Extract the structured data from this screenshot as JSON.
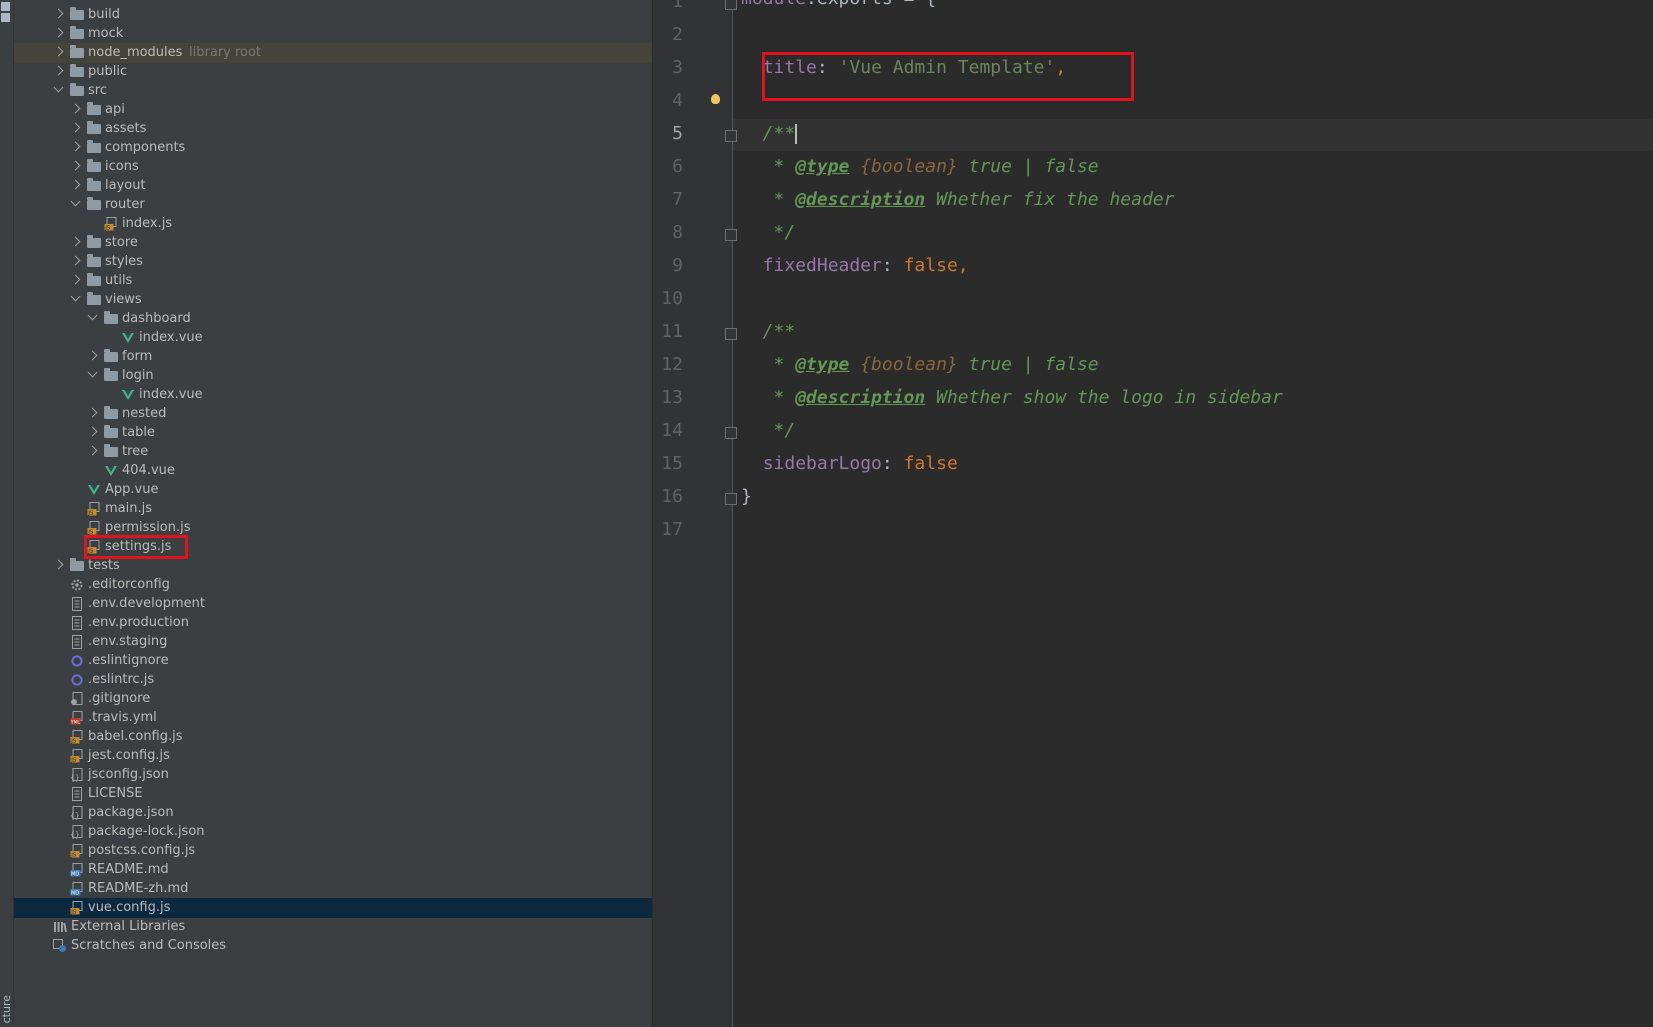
{
  "project_tree": {
    "items": [
      {
        "label": "build",
        "kind": "folder",
        "depth": 1,
        "expander": "closed"
      },
      {
        "label": "mock",
        "kind": "folder",
        "depth": 1,
        "expander": "closed"
      },
      {
        "label": "node_modules",
        "kind": "folder",
        "depth": 1,
        "expander": "closed",
        "hint": "library root",
        "highlight": true
      },
      {
        "label": "public",
        "kind": "folder",
        "depth": 1,
        "expander": "closed"
      },
      {
        "label": "src",
        "kind": "folder",
        "depth": 1,
        "expander": "open"
      },
      {
        "label": "api",
        "kind": "folder",
        "depth": 2,
        "expander": "closed"
      },
      {
        "label": "assets",
        "kind": "folder",
        "depth": 2,
        "expander": "closed"
      },
      {
        "label": "components",
        "kind": "folder",
        "depth": 2,
        "expander": "closed"
      },
      {
        "label": "icons",
        "kind": "folder",
        "depth": 2,
        "expander": "closed"
      },
      {
        "label": "layout",
        "kind": "folder",
        "depth": 2,
        "expander": "closed"
      },
      {
        "label": "router",
        "kind": "folder",
        "depth": 2,
        "expander": "open"
      },
      {
        "label": "index.js",
        "kind": "js",
        "depth": 3
      },
      {
        "label": "store",
        "kind": "folder",
        "depth": 2,
        "expander": "closed"
      },
      {
        "label": "styles",
        "kind": "folder",
        "depth": 2,
        "expander": "closed"
      },
      {
        "label": "utils",
        "kind": "folder",
        "depth": 2,
        "expander": "closed"
      },
      {
        "label": "views",
        "kind": "folder",
        "depth": 2,
        "expander": "open"
      },
      {
        "label": "dashboard",
        "kind": "folder",
        "depth": 3,
        "expander": "open"
      },
      {
        "label": "index.vue",
        "kind": "vue",
        "depth": 4
      },
      {
        "label": "form",
        "kind": "folder",
        "depth": 3,
        "expander": "closed"
      },
      {
        "label": "login",
        "kind": "folder",
        "depth": 3,
        "expander": "open"
      },
      {
        "label": "index.vue",
        "kind": "vue",
        "depth": 4
      },
      {
        "label": "nested",
        "kind": "folder",
        "depth": 3,
        "expander": "closed"
      },
      {
        "label": "table",
        "kind": "folder",
        "depth": 3,
        "expander": "closed"
      },
      {
        "label": "tree",
        "kind": "folder",
        "depth": 3,
        "expander": "closed"
      },
      {
        "label": "404.vue",
        "kind": "vue",
        "depth": 3
      },
      {
        "label": "App.vue",
        "kind": "vue",
        "depth": 2
      },
      {
        "label": "main.js",
        "kind": "js",
        "depth": 2
      },
      {
        "label": "permission.js",
        "kind": "js",
        "depth": 2
      },
      {
        "label": "settings.js",
        "kind": "js",
        "depth": 2,
        "boxed": true
      },
      {
        "label": "tests",
        "kind": "folder",
        "depth": 1,
        "expander": "closed"
      },
      {
        "label": ".editorconfig",
        "kind": "gear",
        "depth": 1
      },
      {
        "label": ".env.development",
        "kind": "file",
        "depth": 1
      },
      {
        "label": ".env.production",
        "kind": "file",
        "depth": 1
      },
      {
        "label": ".env.staging",
        "kind": "file",
        "depth": 1
      },
      {
        "label": ".eslintignore",
        "kind": "eslint",
        "depth": 1
      },
      {
        "label": ".eslintrc.js",
        "kind": "eslint",
        "depth": 1
      },
      {
        "label": ".gitignore",
        "kind": "git",
        "depth": 1
      },
      {
        "label": ".travis.yml",
        "kind": "yml",
        "depth": 1
      },
      {
        "label": "babel.config.js",
        "kind": "js",
        "depth": 1
      },
      {
        "label": "jest.config.js",
        "kind": "js",
        "depth": 1
      },
      {
        "label": "jsconfig.json",
        "kind": "json",
        "depth": 1
      },
      {
        "label": "LICENSE",
        "kind": "file",
        "depth": 1
      },
      {
        "label": "package.json",
        "kind": "json",
        "depth": 1
      },
      {
        "label": "package-lock.json",
        "kind": "json",
        "depth": 1
      },
      {
        "label": "postcss.config.js",
        "kind": "js",
        "depth": 1
      },
      {
        "label": "README.md",
        "kind": "md",
        "depth": 1
      },
      {
        "label": "README-zh.md",
        "kind": "md",
        "depth": 1
      },
      {
        "label": "vue.config.js",
        "kind": "js",
        "depth": 1,
        "selected": true
      },
      {
        "label": "External Libraries",
        "kind": "libs",
        "depth": 0
      },
      {
        "label": "Scratches and Consoles",
        "kind": "scratch",
        "depth": 0
      }
    ]
  },
  "side_strip": {
    "label": "cture"
  },
  "editor": {
    "current_line": 5,
    "lines": [
      {
        "n": "1",
        "fold": "start",
        "tokens": [
          {
            "t": "module",
            "c": "t-prop"
          },
          {
            "t": ".exports = {",
            "c": ""
          }
        ],
        "clip": true
      },
      {
        "n": "2",
        "tokens": []
      },
      {
        "n": "3",
        "boxed": true,
        "tokens": [
          {
            "t": "  ",
            "c": ""
          },
          {
            "t": "title",
            "c": "t-prop"
          },
          {
            "t": ": ",
            "c": ""
          },
          {
            "t": "'Vue Admin Template'",
            "c": "t-str"
          },
          {
            "t": ",",
            "c": "t-kw"
          }
        ]
      },
      {
        "n": "4",
        "bulb": true,
        "tokens": []
      },
      {
        "n": "5",
        "fold": "start",
        "cursor": true,
        "tokens": [
          {
            "t": "  /**",
            "c": "t-doc"
          }
        ]
      },
      {
        "n": "6",
        "tokens": [
          {
            "t": "   * ",
            "c": "t-doc"
          },
          {
            "t": "@type",
            "c": "t-tag"
          },
          {
            "t": " ",
            "c": "t-doc"
          },
          {
            "t": "{boolean}",
            "c": "t-type"
          },
          {
            "t": " true | false",
            "c": "t-doc"
          }
        ]
      },
      {
        "n": "7",
        "tokens": [
          {
            "t": "   * ",
            "c": "t-doc"
          },
          {
            "t": "@description",
            "c": "t-tag"
          },
          {
            "t": " Whether fix the header",
            "c": "t-doc"
          }
        ]
      },
      {
        "n": "8",
        "fold": "end",
        "tokens": [
          {
            "t": "   */",
            "c": "t-doc"
          }
        ]
      },
      {
        "n": "9",
        "tokens": [
          {
            "t": "  ",
            "c": ""
          },
          {
            "t": "fixedHeader",
            "c": "t-prop"
          },
          {
            "t": ": ",
            "c": ""
          },
          {
            "t": "false,",
            "c": "t-kw"
          }
        ]
      },
      {
        "n": "10",
        "tokens": []
      },
      {
        "n": "11",
        "fold": "start",
        "tokens": [
          {
            "t": "  /**",
            "c": "t-doc"
          }
        ]
      },
      {
        "n": "12",
        "tokens": [
          {
            "t": "   * ",
            "c": "t-doc"
          },
          {
            "t": "@type",
            "c": "t-tag"
          },
          {
            "t": " ",
            "c": "t-doc"
          },
          {
            "t": "{boolean}",
            "c": "t-type"
          },
          {
            "t": " true | false",
            "c": "t-doc"
          }
        ]
      },
      {
        "n": "13",
        "tokens": [
          {
            "t": "   * ",
            "c": "t-doc"
          },
          {
            "t": "@description",
            "c": "t-tag"
          },
          {
            "t": " Whether show the logo in sidebar",
            "c": "t-doc"
          }
        ]
      },
      {
        "n": "14",
        "fold": "end",
        "tokens": [
          {
            "t": "   */",
            "c": "t-doc"
          }
        ]
      },
      {
        "n": "15",
        "tokens": [
          {
            "t": "  ",
            "c": ""
          },
          {
            "t": "sidebarLogo",
            "c": "t-prop"
          },
          {
            "t": ": ",
            "c": ""
          },
          {
            "t": "false",
            "c": "t-kw"
          }
        ]
      },
      {
        "n": "16",
        "fold": "end",
        "tokens": [
          {
            "t": "}",
            "c": ""
          }
        ]
      },
      {
        "n": "17",
        "tokens": []
      }
    ]
  },
  "colors": {
    "tree_bg": "#3c3f41",
    "editor_bg": "#2b2b2b",
    "selection": "#0d293e",
    "highlight_red": "#e0141e",
    "vue_green": "#41b883",
    "js_orange": "#c28c2a"
  }
}
